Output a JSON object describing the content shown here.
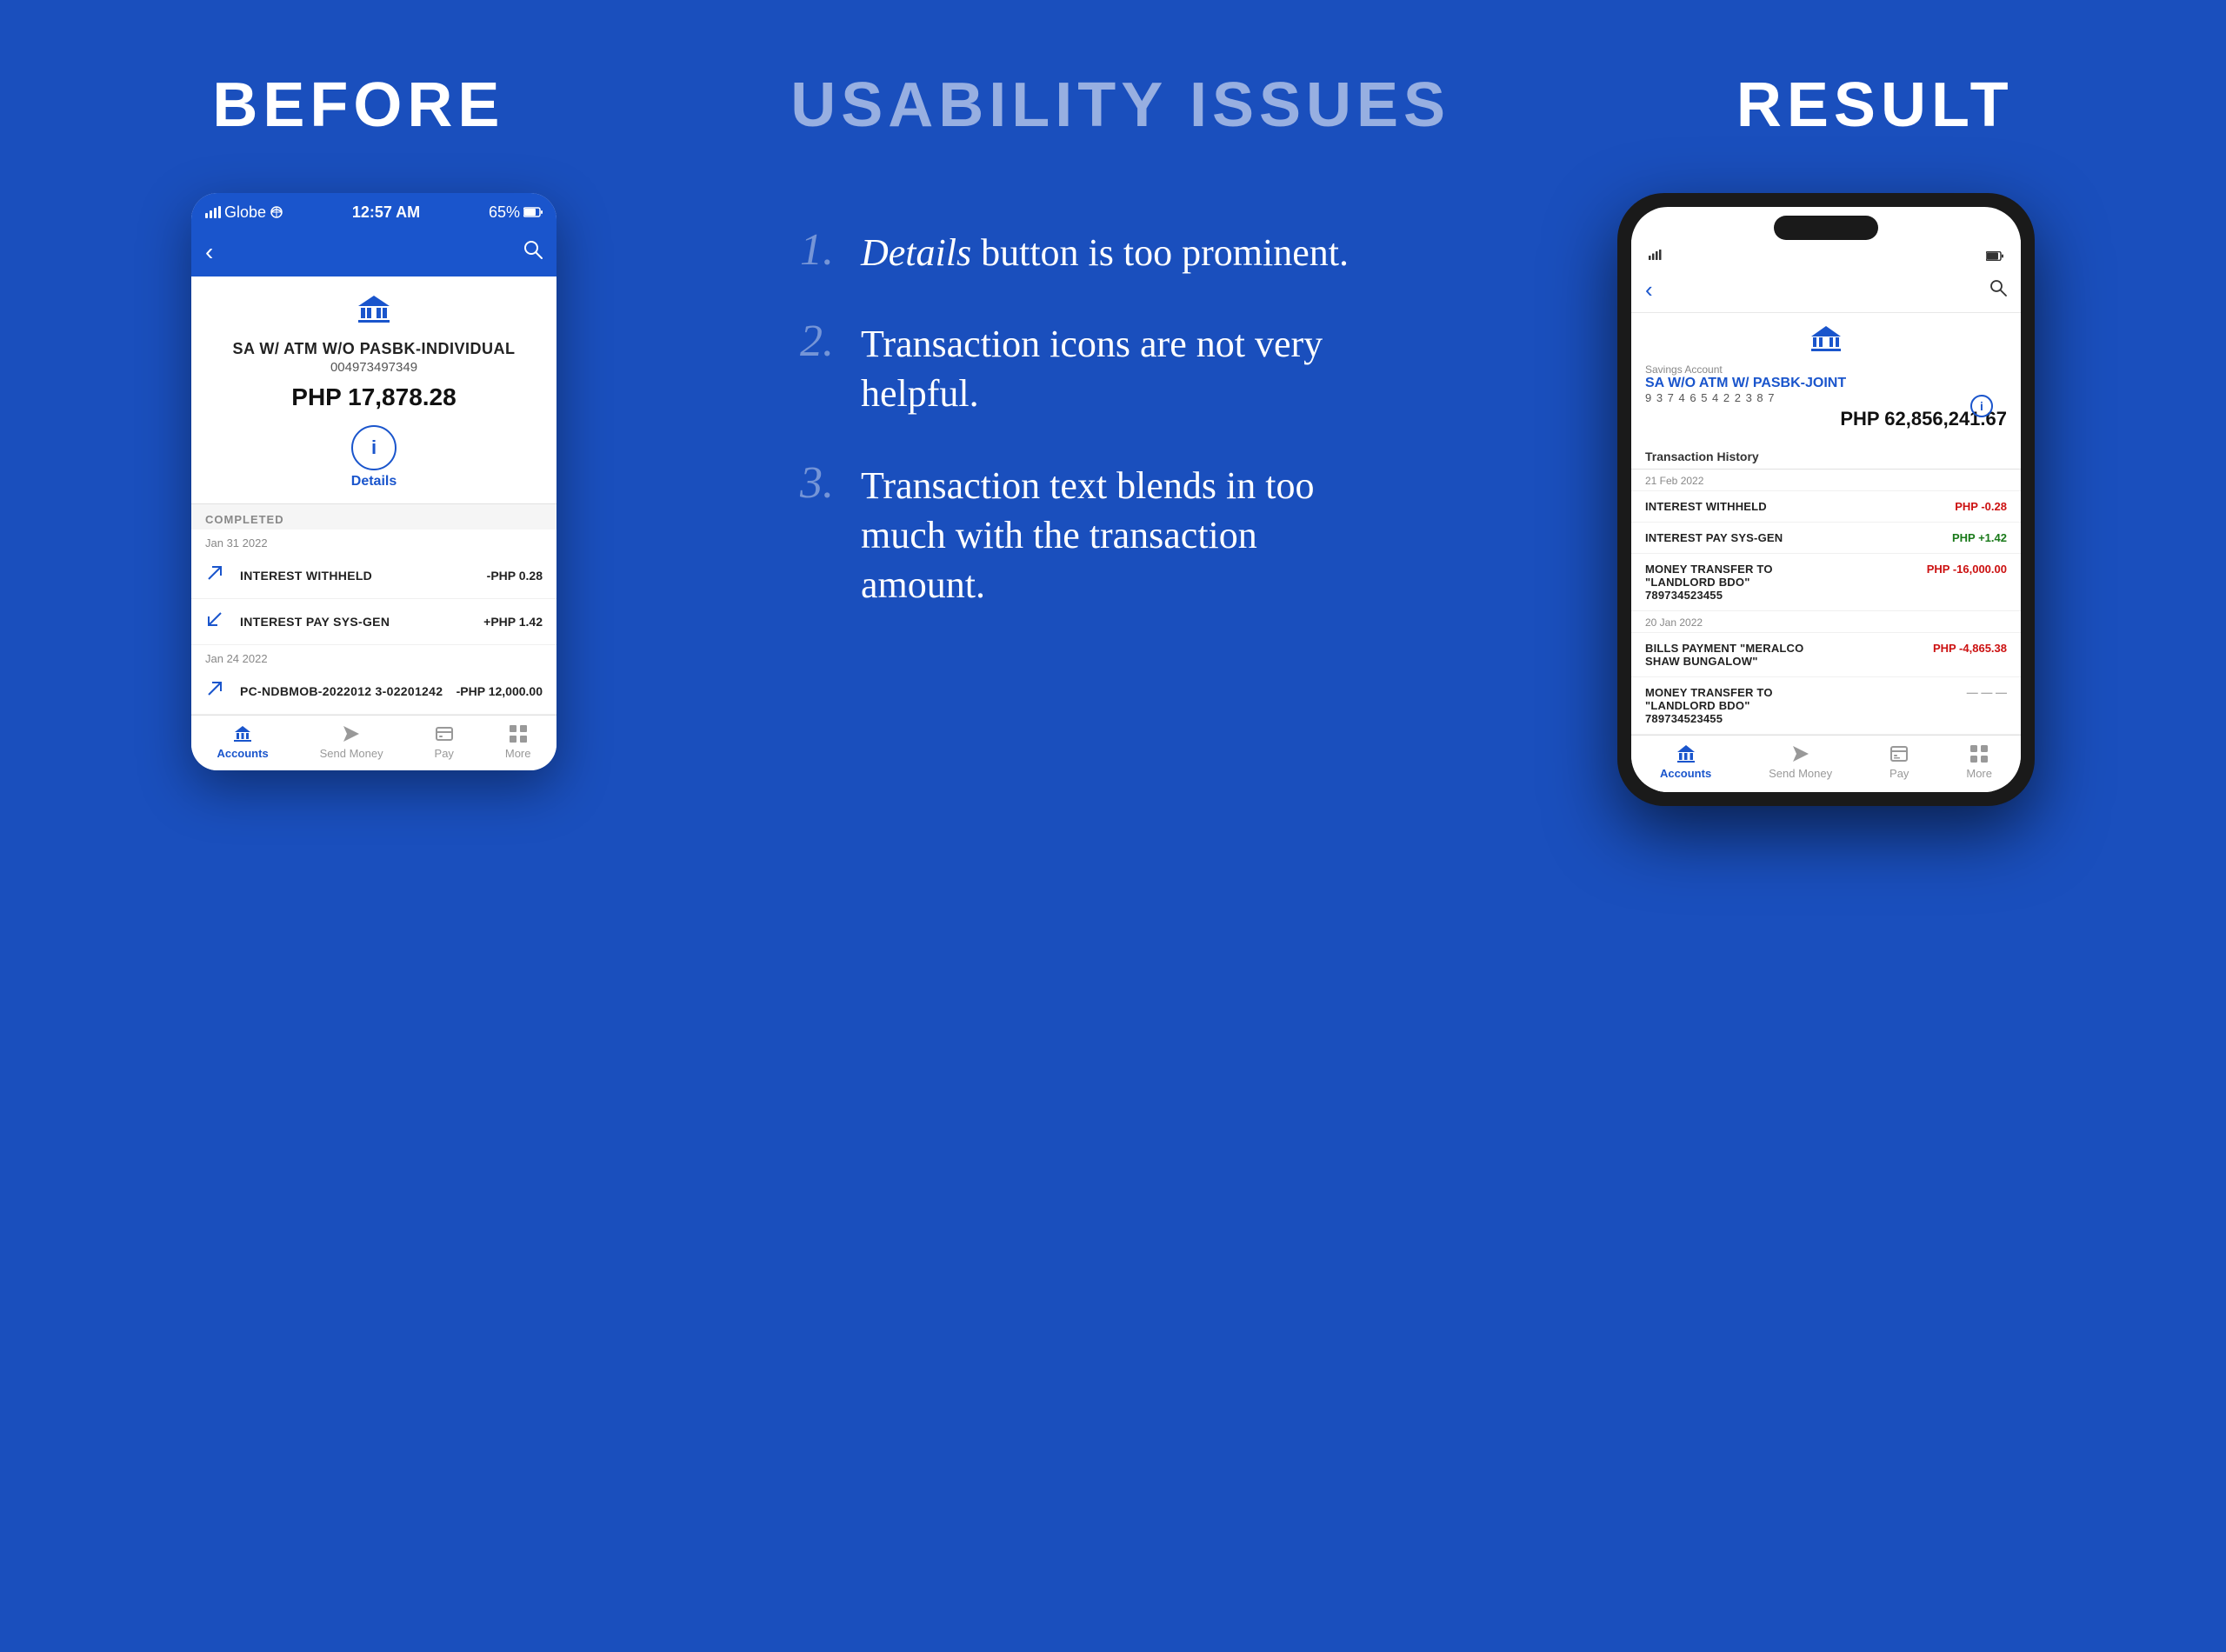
{
  "header": {
    "before_label": "BEFORE",
    "issues_label": "USABILITY ISSUES",
    "result_label": "RESULT"
  },
  "before_phone": {
    "status": {
      "signal": "●●● Globe",
      "time": "12:57 AM",
      "battery": "65%"
    },
    "account": {
      "name": "SA W/ ATM W/O PASBK-INDIVIDUAL",
      "number": "004973497349",
      "balance": "PHP 17,878.28"
    },
    "details_label": "Details",
    "completed_label": "COMPLETED",
    "date1": "Jan 31 2022",
    "transactions1": [
      {
        "name": "INTEREST WITHHELD",
        "amount": "-PHP 0.28",
        "type": "negative"
      },
      {
        "name": "INTEREST PAY SYS-GEN",
        "amount": "+PHP 1.42",
        "type": "positive"
      }
    ],
    "date2": "Jan 24 2022",
    "transactions2": [
      {
        "name": "PC-NDBMOB-2022012 3-02201242",
        "amount": "-PHP 12,000.00",
        "type": "negative"
      }
    ],
    "bottom_nav": [
      {
        "label": "Accounts",
        "active": true
      },
      {
        "label": "Send Money",
        "active": false
      },
      {
        "label": "Pay",
        "active": false
      },
      {
        "label": "More",
        "active": false
      }
    ]
  },
  "issues": [
    {
      "number": "1.",
      "text_before": "",
      "italic": "Details",
      "text_after": " button is too prominent."
    },
    {
      "number": "2.",
      "text_before": "Transaction icons are not very helpful.",
      "italic": "",
      "text_after": ""
    },
    {
      "number": "3.",
      "text_before": "Transaction text blends in too much with the transaction amount.",
      "italic": "",
      "text_after": ""
    }
  ],
  "result_phone": {
    "account": {
      "savings_label": "Savings Account",
      "name": "SA W/O ATM W/ PASBK-JOINT",
      "number": "9 3 7 4 6 5 4 2 2 3 8 7",
      "balance": "PHP 62,856,241.67"
    },
    "txn_history_label": "Transaction History",
    "date1": "21 Feb 2022",
    "transactions1": [
      {
        "name": "INTEREST WITHHELD",
        "amount": "PHP -0.28",
        "type": "neg"
      },
      {
        "name": "INTEREST PAY SYS-GEN",
        "amount": "PHP +1.42",
        "type": "pos"
      },
      {
        "name": "MONEY TRANSFER TO \"LANDLORD BDO\" 789734523455",
        "amount": "PHP -16,000.00",
        "type": "neg"
      }
    ],
    "date2": "20 Jan 2022",
    "transactions2": [
      {
        "name": "BILLS PAYMENT \"MERALCO SHAW BUNGALOW\"",
        "amount": "PHP -4,865.38",
        "type": "neg"
      },
      {
        "name": "MONEY TRANSFER TO \"LANDLORD BDO\" 789734523455",
        "amount": "...",
        "type": "neg"
      }
    ],
    "bottom_nav": [
      {
        "label": "Accounts",
        "active": true
      },
      {
        "label": "Send Money",
        "active": false
      },
      {
        "label": "Pay",
        "active": false
      },
      {
        "label": "More",
        "active": false
      }
    ]
  },
  "colors": {
    "primary": "#1a55cc",
    "bg": "#1a4fbd",
    "negative": "#cc1111",
    "positive": "#1a7a1a"
  }
}
